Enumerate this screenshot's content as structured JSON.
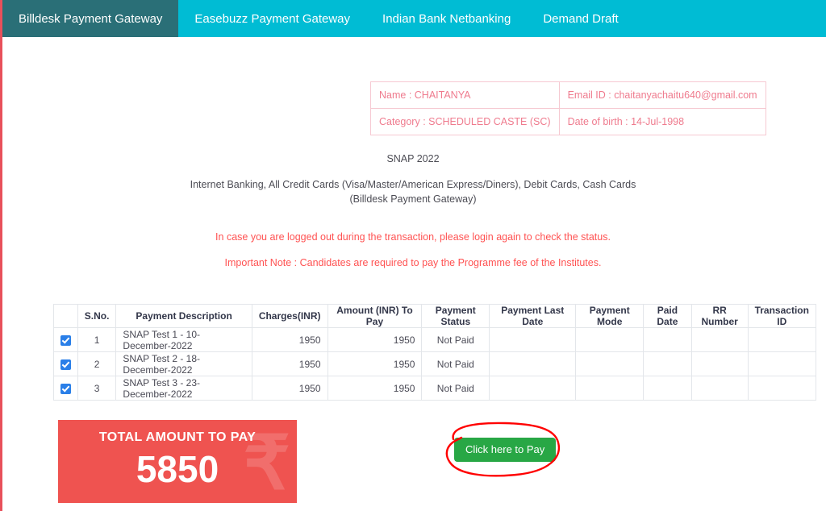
{
  "navbar": {
    "tabs": [
      {
        "label": "Billdesk Payment Gateway",
        "active": true
      },
      {
        "label": "Easebuzz Payment Gateway",
        "active": false
      },
      {
        "label": "Indian Bank Netbanking",
        "active": false
      },
      {
        "label": "Demand Draft",
        "active": false
      }
    ]
  },
  "candidate_info": {
    "name": "Name : CHAITANYA",
    "email": "Email ID : chaitanyachaitu640@gmail.com",
    "category": "Category : SCHEDULED CASTE (SC)",
    "dob": "Date of birth : 14-Jul-1998"
  },
  "exam": {
    "title": "SNAP 2022",
    "modes_line_1": "Internet Banking, All Credit Cards (Visa/Master/American Express/Diners), Debit Cards, Cash Cards",
    "modes_line_2": "(Billdesk Payment Gateway)"
  },
  "notices": {
    "logout_notice": "In case you are logged out during the transaction, please login again to check the status.",
    "important_note": "Important Note : Candidates are required to pay the Programme fee of the Institutes."
  },
  "payment_table": {
    "headers": {
      "select": "",
      "sno": "S.No.",
      "description": "Payment Description",
      "charges": "Charges(INR)",
      "amount": "Amount   (INR) To Pay",
      "status": "Payment Status",
      "last_date": "Payment Last Date",
      "mode": "Payment Mode",
      "paid_date": "Paid Date",
      "rr_number": "RR Number",
      "transaction_id": "Transaction ID"
    },
    "rows": [
      {
        "checked": true,
        "sno": "1",
        "description": "SNAP Test 1 - 10-December-2022",
        "charges": "1950",
        "amount": "1950",
        "status": "Not Paid",
        "last_date": "",
        "mode": "",
        "paid_date": "",
        "rr_number": "",
        "transaction_id": ""
      },
      {
        "checked": true,
        "sno": "2",
        "description": "SNAP Test 2 - 18-December-2022",
        "charges": "1950",
        "amount": "1950",
        "status": "Not Paid",
        "last_date": "",
        "mode": "",
        "paid_date": "",
        "rr_number": "",
        "transaction_id": ""
      },
      {
        "checked": true,
        "sno": "3",
        "description": "SNAP Test 3 - 23-December-2022",
        "charges": "1950",
        "amount": "1950",
        "status": "Not Paid",
        "last_date": "",
        "mode": "",
        "paid_date": "",
        "rr_number": "",
        "transaction_id": ""
      }
    ]
  },
  "total_panel": {
    "label": "TOTAL AMOUNT TO PAY",
    "value": "5850",
    "currency_symbol": "₹"
  },
  "actions": {
    "pay_button": "Click here to Pay"
  },
  "colors": {
    "navbar": "#00bcd4",
    "navbar_active": "#2a6f77",
    "total_panel": "#ef5350",
    "pay_button": "#28a745",
    "notice_text": "#ff5252",
    "info_text": "#ef7b8e",
    "annotation": "#ff0000",
    "left_rule": "#e8505b",
    "checkbox": "#2a7fe8"
  }
}
